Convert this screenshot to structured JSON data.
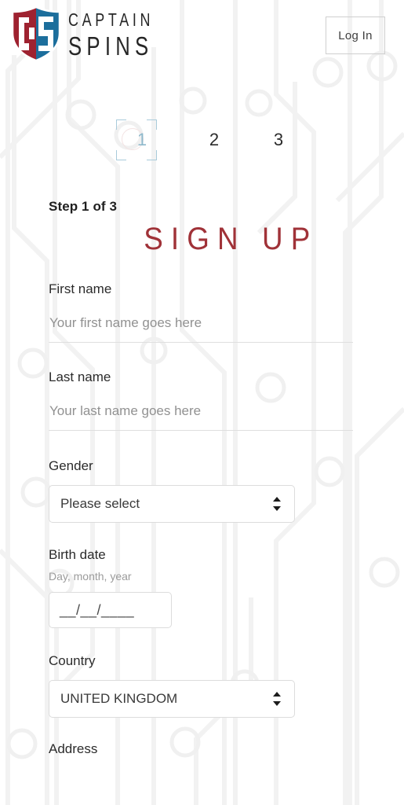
{
  "header": {
    "logo": {
      "icon": "captain-spins-shield-logo",
      "word_top": "CAPTAIN",
      "word_bottom": "SPINS",
      "color_red": "#9e2230",
      "color_blue": "#1c6e9c"
    },
    "login_label": "Log In"
  },
  "steps": {
    "items": [
      {
        "number": "1",
        "active": true
      },
      {
        "number": "2",
        "active": false
      },
      {
        "number": "3",
        "active": false
      }
    ],
    "active_color": "#8fb9cc",
    "inactive_color": "#2b2b2b"
  },
  "form": {
    "step_text": "Step 1 of 3",
    "title": "SIGN UP",
    "title_color": "#a03238",
    "fields": {
      "first_name": {
        "label": "First name",
        "placeholder": "Your first name goes here",
        "value": ""
      },
      "last_name": {
        "label": "Last name",
        "placeholder": "Your last name goes here",
        "value": ""
      },
      "gender": {
        "label": "Gender",
        "selected": "Please select"
      },
      "birth_date": {
        "label": "Birth date",
        "hint": "Day, month, year",
        "mask": "__/__/____"
      },
      "country": {
        "label": "Country",
        "selected": "UNITED KINGDOM"
      },
      "address": {
        "label": "Address"
      }
    }
  }
}
